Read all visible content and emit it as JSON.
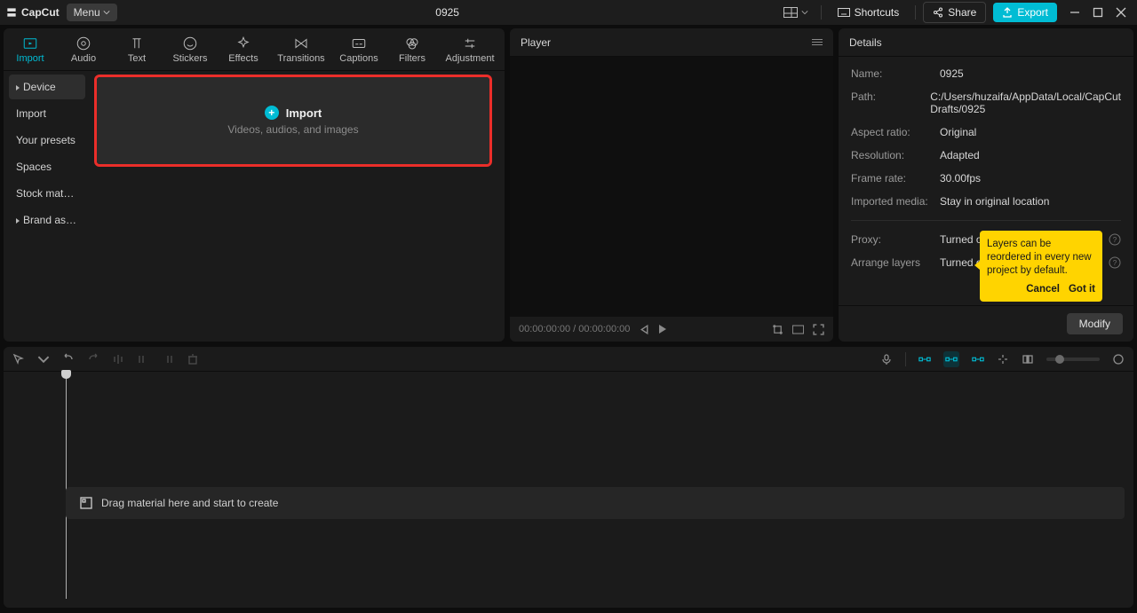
{
  "titlebar": {
    "app_name": "CapCut",
    "menu_label": "Menu",
    "project_title": "0925",
    "shortcuts_label": "Shortcuts",
    "share_label": "Share",
    "export_label": "Export"
  },
  "media_tabs": [
    {
      "id": "import",
      "label": "Import"
    },
    {
      "id": "audio",
      "label": "Audio"
    },
    {
      "id": "text",
      "label": "Text"
    },
    {
      "id": "stickers",
      "label": "Stickers"
    },
    {
      "id": "effects",
      "label": "Effects"
    },
    {
      "id": "transitions",
      "label": "Transitions"
    },
    {
      "id": "captions",
      "label": "Captions"
    },
    {
      "id": "filters",
      "label": "Filters"
    },
    {
      "id": "adjustment",
      "label": "Adjustment"
    }
  ],
  "side_nav": [
    {
      "id": "device",
      "label": "Device",
      "expandable": true,
      "selected": true
    },
    {
      "id": "import",
      "label": "Import"
    },
    {
      "id": "presets",
      "label": "Your presets"
    },
    {
      "id": "spaces",
      "label": "Spaces"
    },
    {
      "id": "stock",
      "label": "Stock mater..."
    },
    {
      "id": "brand",
      "label": "Brand assets",
      "expandable": true
    }
  ],
  "import_box": {
    "title": "Import",
    "subtitle": "Videos, audios, and images"
  },
  "player": {
    "header": "Player",
    "timecode": "00:00:00:00 / 00:00:00:00"
  },
  "details": {
    "header": "Details",
    "rows": {
      "name": {
        "label": "Name:",
        "value": "0925"
      },
      "path": {
        "label": "Path:",
        "value": "C:/Users/huzaifa/AppData/Local/CapCut Drafts/0925"
      },
      "aspect": {
        "label": "Aspect ratio:",
        "value": "Original"
      },
      "resolution": {
        "label": "Resolution:",
        "value": "Adapted"
      },
      "framerate": {
        "label": "Frame rate:",
        "value": "30.00fps"
      },
      "imported": {
        "label": "Imported media:",
        "value": "Stay in original location"
      },
      "proxy": {
        "label": "Proxy:",
        "value": "Turned off"
      },
      "arrange": {
        "label": "Arrange layers",
        "value": "Turned on"
      }
    },
    "modify": "Modify"
  },
  "tooltip": {
    "text": "Layers can be reordered in every new project by default.",
    "cancel": "Cancel",
    "gotit": "Got it"
  },
  "timeline": {
    "drop_hint": "Drag material here and start to create"
  }
}
